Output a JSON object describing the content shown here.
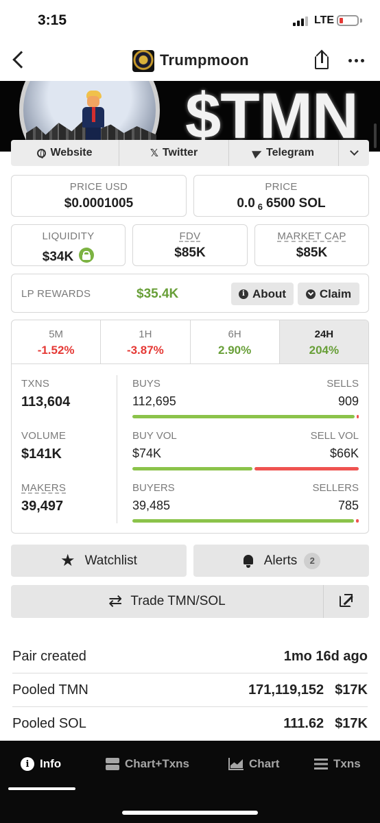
{
  "status_bar": {
    "time": "3:15",
    "network": "LTE",
    "battery_level": 0.1,
    "battery_color": "#e53935"
  },
  "header": {
    "back_icon": "chevron-left-icon",
    "title": "Trumpmoon",
    "share_icon": "share-icon",
    "more_icon": "more-horizontal-icon"
  },
  "banner": {
    "ticker": "$TMN"
  },
  "links": {
    "website": "Website",
    "twitter": "Twitter",
    "telegram": "Telegram",
    "expand_icon": "chevron-down-icon"
  },
  "price": {
    "usd_label": "PRICE USD",
    "usd_value": "$0.0001005",
    "native_label": "PRICE",
    "native_prefix": "0.0",
    "native_zero_count": "6",
    "native_digits": "6500 SOL"
  },
  "metrics": {
    "liquidity_label": "LIQUIDITY",
    "liquidity_value": "$34K",
    "fdv_label": "FDV",
    "fdv_value": "$85K",
    "mcap_label": "MARKET CAP",
    "mcap_value": "$85K"
  },
  "lp": {
    "label": "LP REWARDS",
    "value": "$35.4K",
    "about_label": "About",
    "claim_label": "Claim"
  },
  "timeframes": [
    {
      "label": "5M",
      "change": "-1.52%",
      "direction": "neg"
    },
    {
      "label": "1H",
      "change": "-3.87%",
      "direction": "neg"
    },
    {
      "label": "6H",
      "change": "2.90%",
      "direction": "pos"
    },
    {
      "label": "24H",
      "change": "204%",
      "direction": "pos",
      "active": true
    }
  ],
  "stats": {
    "txns": {
      "label": "TXNS",
      "value": "113,604"
    },
    "volume": {
      "label": "VOLUME",
      "value": "$141K"
    },
    "makers": {
      "label": "MAKERS",
      "value": "39,497"
    },
    "buys_sells": {
      "left_label": "BUYS",
      "right_label": "SELLS",
      "left_value": "112,695",
      "right_value": "909",
      "left_share": 0.992
    },
    "vol_split": {
      "left_label": "BUY VOL",
      "right_label": "SELL VOL",
      "left_value": "$74K",
      "right_value": "$66K",
      "left_share": 0.53
    },
    "buyers_sellers": {
      "left_label": "BUYERS",
      "right_label": "SELLERS",
      "left_value": "39,485",
      "right_value": "785",
      "left_share": 0.98
    }
  },
  "actions": {
    "watchlist_label": "Watchlist",
    "alerts_label": "Alerts",
    "alerts_count": "2",
    "trade_label": "Trade TMN/SOL"
  },
  "pair_info": {
    "created_label": "Pair created",
    "created_value": "1mo 16d ago",
    "pooled_token_label": "Pooled TMN",
    "pooled_token_amount": "171,119,152",
    "pooled_token_usd": "$17K",
    "pooled_sol_label": "Pooled SOL",
    "pooled_sol_amount": "111.62",
    "pooled_sol_usd": "$17K"
  },
  "tab_bar": {
    "info": "Info",
    "chart_txns": "Chart+Txns",
    "chart": "Chart",
    "txns": "Txns"
  },
  "colors": {
    "positive": "#689f38",
    "negative": "#e53935",
    "bar_buy": "#8bc34a",
    "bar_sell": "#ef5350"
  }
}
